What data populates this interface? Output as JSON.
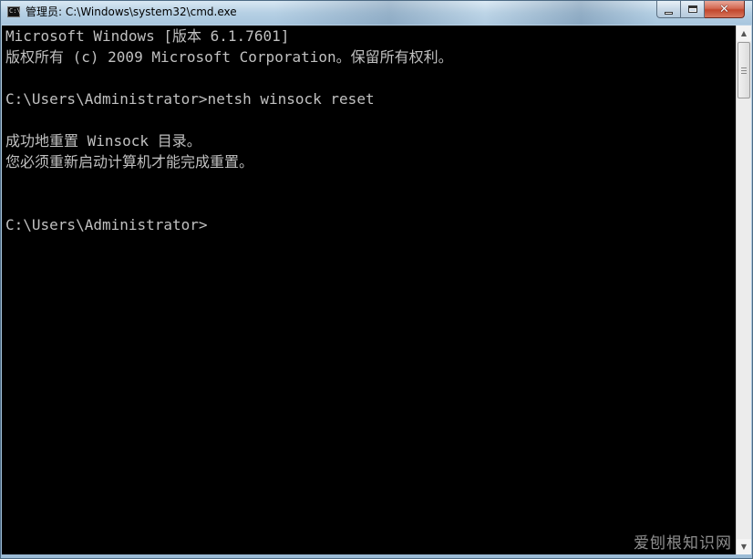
{
  "window": {
    "title": "管理员: C:\\Windows\\system32\\cmd.exe",
    "icon": "cmd-icon",
    "icon_text": "C:\\"
  },
  "caption_buttons": {
    "minimize": "minimize-icon",
    "maximize": "maximize-icon",
    "close_glyph": "✕"
  },
  "console": {
    "text_color": "#c0c0c0",
    "background": "#000000",
    "lines": [
      "Microsoft Windows [版本 6.1.7601]",
      "版权所有 (c) 2009 Microsoft Corporation。保留所有权利。",
      "",
      "C:\\Users\\Administrator>netsh winsock reset",
      "",
      "成功地重置 Winsock 目录。",
      "您必须重新启动计算机才能完成重置。",
      "",
      "",
      "C:\\Users\\Administrator>"
    ]
  },
  "scrollbar": {
    "up_arrow": "▲",
    "down_arrow": "▼"
  },
  "watermark": "爱刨根知识网"
}
